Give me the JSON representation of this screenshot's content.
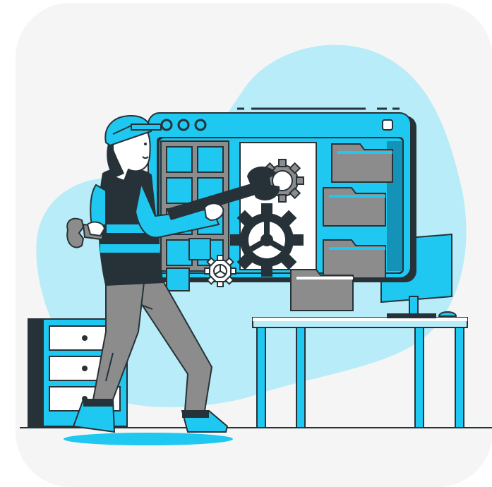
{
  "illustration": {
    "subject": "",
    "palette": {
      "accent": "#1ec8f0",
      "accent_light": "#b8ecf8",
      "dark": "#263238",
      "gray": "#8c8c8c",
      "gray_light": "#a8a8a8",
      "card_bg": "#f5f5f5",
      "white": "#ffffff"
    },
    "icons": [
      "wrench-icon",
      "gear-icon",
      "folder-icon",
      "monitor-icon",
      "mouse-icon",
      "hard-hat-icon"
    ]
  }
}
